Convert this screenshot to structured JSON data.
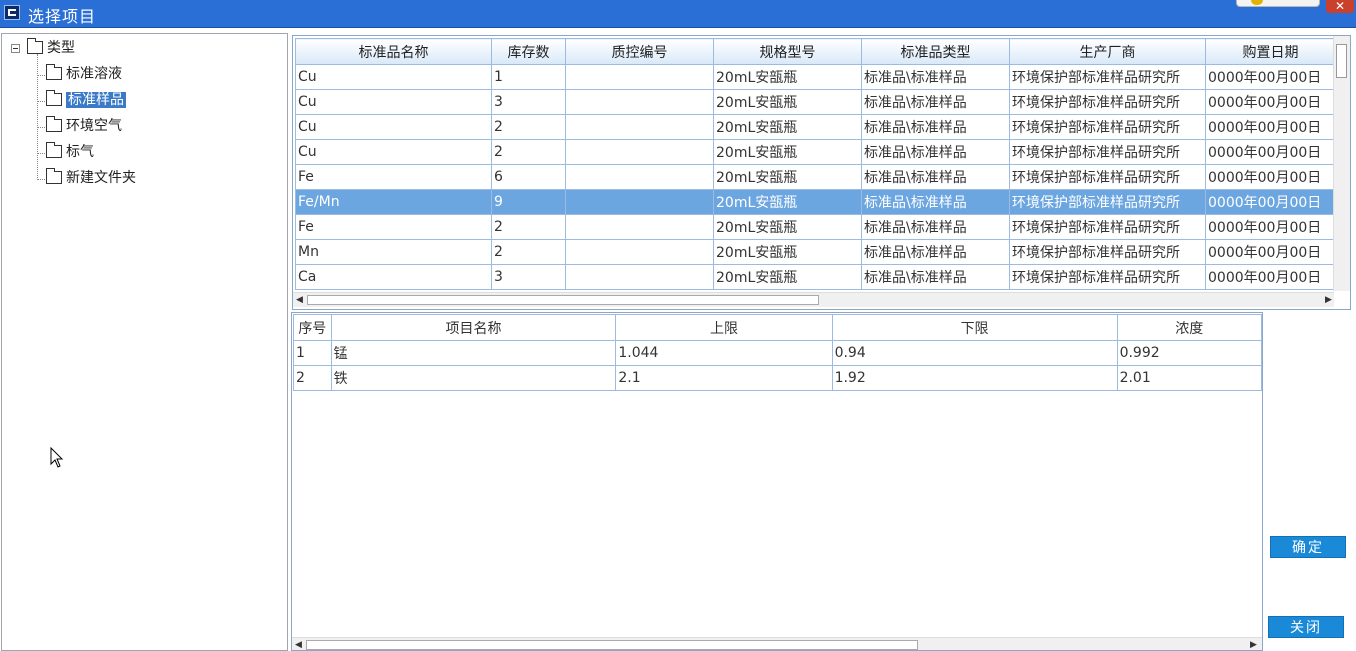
{
  "window": {
    "title": "选择项目",
    "close_label": "✕"
  },
  "tree": {
    "root": {
      "label": "类型",
      "icon": "folder-icon"
    },
    "children": [
      {
        "label": "标准溶液",
        "selected": false
      },
      {
        "label": "标准样品",
        "selected": true
      },
      {
        "label": "环境空气",
        "selected": false
      },
      {
        "label": "标气",
        "selected": false
      },
      {
        "label": "新建文件夹",
        "selected": false
      }
    ]
  },
  "standards_grid": {
    "columns": [
      "标准品名称",
      "库存数",
      "质控编号",
      "规格型号",
      "标准品类型",
      "生产厂商",
      "购置日期"
    ],
    "rows": [
      [
        "Cu",
        "1",
        "",
        "20mL安瓿瓶",
        "标准品\\标准样品",
        "环境保护部标准样品研究所",
        "0000年00月00日"
      ],
      [
        "Cu",
        "3",
        "",
        "20mL安瓿瓶",
        "标准品\\标准样品",
        "环境保护部标准样品研究所",
        "0000年00月00日"
      ],
      [
        "Cu",
        "2",
        "",
        "20mL安瓿瓶",
        "标准品\\标准样品",
        "环境保护部标准样品研究所",
        "0000年00月00日"
      ],
      [
        "Cu",
        "2",
        "",
        "20mL安瓿瓶",
        "标准品\\标准样品",
        "环境保护部标准样品研究所",
        "0000年00月00日"
      ],
      [
        "Fe",
        "6",
        "",
        "20mL安瓿瓶",
        "标准品\\标准样品",
        "环境保护部标准样品研究所",
        "0000年00月00日"
      ],
      [
        "Fe/Mn",
        "9",
        "",
        "20mL安瓿瓶",
        "标准品\\标准样品",
        "环境保护部标准样品研究所",
        "0000年00月00日"
      ],
      [
        "Fe",
        "2",
        "",
        "20mL安瓿瓶",
        "标准品\\标准样品",
        "环境保护部标准样品研究所",
        "0000年00月00日"
      ],
      [
        "Mn",
        "2",
        "",
        "20mL安瓿瓶",
        "标准品\\标准样品",
        "环境保护部标准样品研究所",
        "0000年00月00日"
      ],
      [
        "Ca",
        "3",
        "",
        "20mL安瓿瓶",
        "标准品\\标准样品",
        "环境保护部标准样品研究所",
        "0000年00月00日"
      ]
    ],
    "selected_row": 5
  },
  "items_grid": {
    "columns": [
      "序号",
      "项目名称",
      "上限",
      "下限",
      "浓度"
    ],
    "rows": [
      [
        "1",
        "锰",
        "1.044",
        "0.94",
        "0.992"
      ],
      [
        "2",
        "铁",
        "2.1",
        "1.92",
        "2.01"
      ]
    ]
  },
  "buttons": {
    "confirm_label": "确定",
    "close_label": "关闭"
  },
  "colors": {
    "titlebar": "#2a6fd6",
    "selection": "#6ca6e0",
    "button": "#1a8ad8",
    "tree_selection": "#3a7ac7"
  }
}
